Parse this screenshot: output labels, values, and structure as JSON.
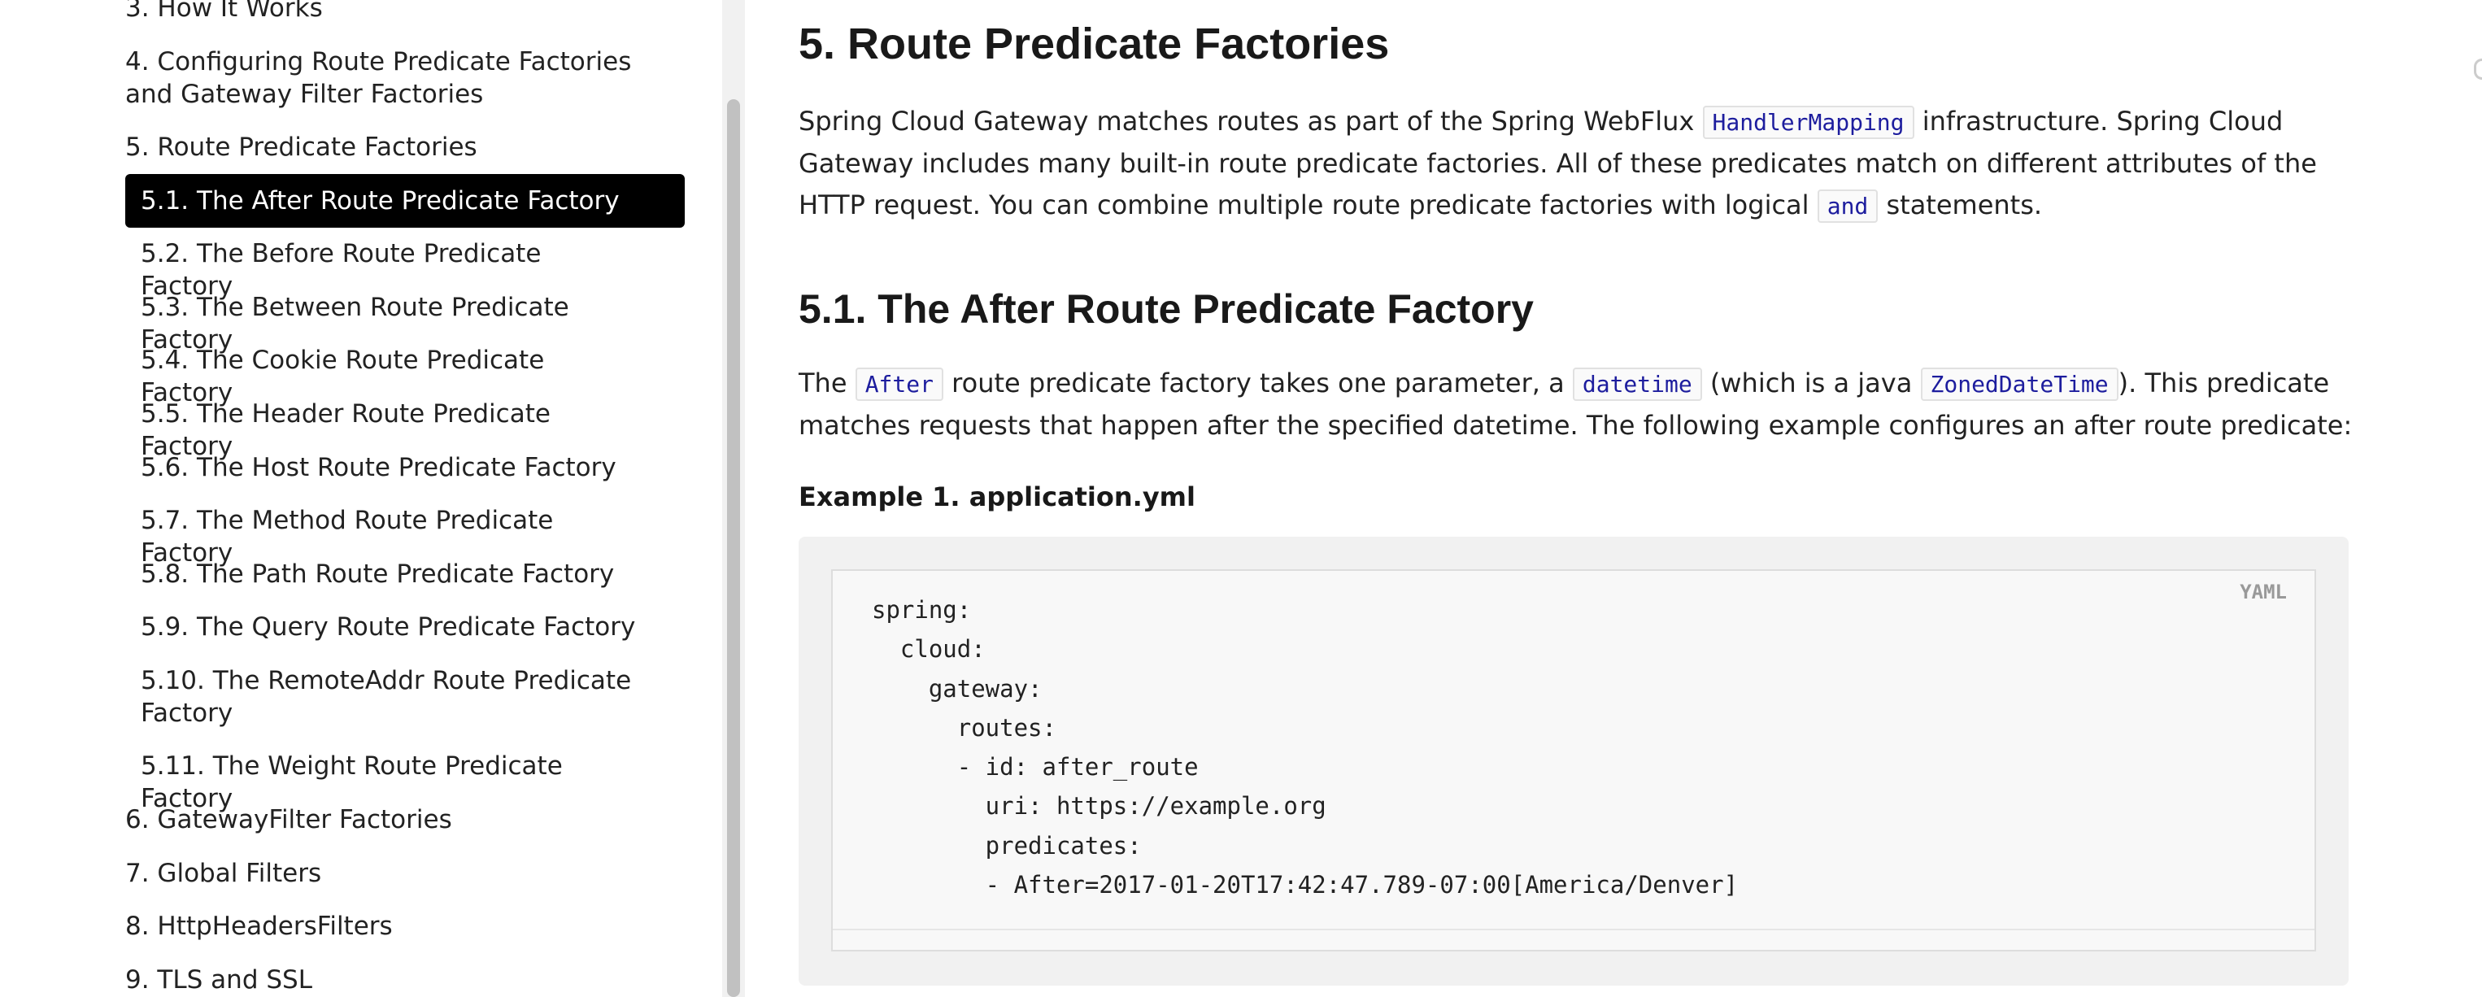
{
  "sidebar": {
    "items": [
      {
        "label": "3. How It Works",
        "level": 1
      },
      {
        "label": "4. Configuring Route Predicate Factories and Gateway Filter Factories",
        "level": 1
      },
      {
        "label": "5. Route Predicate Factories",
        "level": 1
      },
      {
        "label": "5.1. The After Route Predicate Factory",
        "level": 2,
        "active": true
      },
      {
        "label": "5.2. The Before Route Predicate Factory",
        "level": 2
      },
      {
        "label": "5.3. The Between Route Predicate Factory",
        "level": 2
      },
      {
        "label": "5.4. The Cookie Route Predicate Factory",
        "level": 2
      },
      {
        "label": "5.5. The Header Route Predicate Factory",
        "level": 2
      },
      {
        "label": "5.6. The Host Route Predicate Factory",
        "level": 2
      },
      {
        "label": "5.7. The Method Route Predicate Factory",
        "level": 2
      },
      {
        "label": "5.8. The Path Route Predicate Factory",
        "level": 2
      },
      {
        "label": "5.9. The Query Route Predicate Factory",
        "level": 2
      },
      {
        "label": "5.10. The RemoteAddr Route Predicate Factory",
        "level": 2
      },
      {
        "label": "5.11. The Weight Route Predicate Factory",
        "level": 2
      },
      {
        "label": "6. GatewayFilter Factories",
        "level": 1
      },
      {
        "label": "7. Global Filters",
        "level": 1
      },
      {
        "label": "8. HttpHeadersFilters",
        "level": 1
      },
      {
        "label": "9. TLS and SSL",
        "level": 1
      }
    ]
  },
  "main": {
    "section_title": "5. Route Predicate Factories",
    "intro": {
      "t1": "Spring Cloud Gateway matches routes as part of the Spring WebFlux ",
      "c1": "HandlerMapping",
      "t2": " infrastructure. Spring Cloud Gateway includes many built-in route predicate factories. All of these predicates match on different attributes of the HTTP request. You can combine multiple route predicate factories with logical ",
      "c2": "and",
      "t3": " statements."
    },
    "subsection_title": "5.1. The After Route Predicate Factory",
    "after_para": {
      "t1": "The ",
      "c1": "After",
      "t2": " route predicate factory takes one parameter, a ",
      "c2": "datetime",
      "t3": " (which is a java ",
      "c3": "ZonedDateTime",
      "t4": "). This predicate matches requests that happen after the specified datetime. The following example configures an after route predicate:"
    },
    "example_title": "Example 1. application.yml",
    "code": {
      "language": "YAML",
      "lines": [
        "spring:",
        "  cloud:",
        "    gateway:",
        "      routes:",
        "      - id: after_route",
        "        uri: https://example.org",
        "        predicates:",
        "        - After=2017-01-20T17:42:47.789-07:00[America/Denver]"
      ]
    }
  }
}
